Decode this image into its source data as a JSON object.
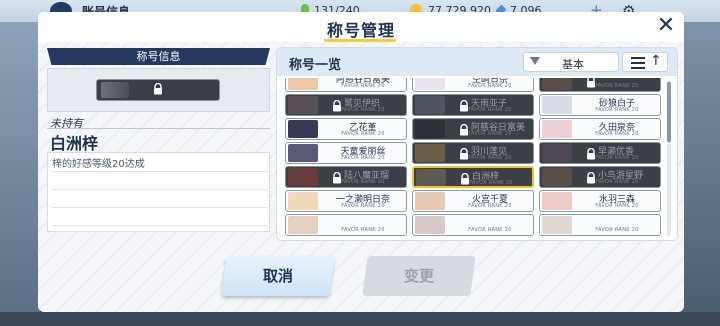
{
  "background": {
    "title": "账号信息",
    "ap": "131/240",
    "credits": "77,729,920",
    "gems": "7,096"
  },
  "modal": {
    "title": "称号管理"
  },
  "left": {
    "header": "称号信息",
    "status": "未持有",
    "holder": "白洲梓",
    "description": "梓的好感等级20达成"
  },
  "list": {
    "title": "称号一览",
    "sort_label": "基本",
    "rank_text": "FAVOR RANK 20",
    "rows": [
      [
        {
          "name": "阿慈谷日富美",
          "locked": false,
          "tone": "#f0c8a8"
        },
        {
          "name": "空崎日奈",
          "locked": false,
          "tone": "#e8e4ee"
        },
        {
          "name": "",
          "locked": true,
          "tone": "#5a4e4a"
        }
      ],
      [
        {
          "name": "鹫见伊织",
          "locked": true,
          "tone": "#5a5058"
        },
        {
          "name": "天雨亚子",
          "locked": true,
          "tone": "#4e5460"
        },
        {
          "name": "砂狼白子",
          "locked": false,
          "tone": "#d8dce6"
        }
      ],
      [
        {
          "name": "乙花堇",
          "locked": false,
          "tone": "#3a3a56"
        },
        {
          "name": "阿慈谷日富美",
          "locked": true,
          "tone": "#2e2e36"
        },
        {
          "name": "久田泉奈",
          "locked": false,
          "tone": "#f0d0d8"
        }
      ],
      [
        {
          "name": "天童爱丽丝",
          "locked": false,
          "tone": "#5a5a78"
        },
        {
          "name": "羽川莲见",
          "locked": true,
          "tone": "#6a5e48"
        },
        {
          "name": "早濑优香",
          "locked": true,
          "tone": "#4e4650"
        }
      ],
      [
        {
          "name": "陆八魔亚瑠",
          "locked": true,
          "tone": "#6a3a3a"
        },
        {
          "name": "白洲梓",
          "locked": true,
          "tone": "#5e5a52",
          "selected": true
        },
        {
          "name": "小鸟游星野",
          "locked": true,
          "tone": "#5a5048"
        }
      ],
      [
        {
          "name": "一之濑明日奈",
          "locked": false,
          "tone": "#f0d8b8"
        },
        {
          "name": "火宫千夏",
          "locked": false,
          "tone": "#e8c8b0"
        },
        {
          "name": "水羽三森",
          "locked": false,
          "tone": "#f0c8c8"
        }
      ],
      [
        {
          "name": "",
          "locked": false,
          "tone": "#e8d0c0"
        },
        {
          "name": "",
          "locked": false,
          "tone": "#d8c8c8"
        },
        {
          "name": "",
          "locked": false,
          "tone": "#e0d8d0"
        }
      ]
    ]
  },
  "buttons": {
    "cancel": "取消",
    "change": "变更"
  }
}
